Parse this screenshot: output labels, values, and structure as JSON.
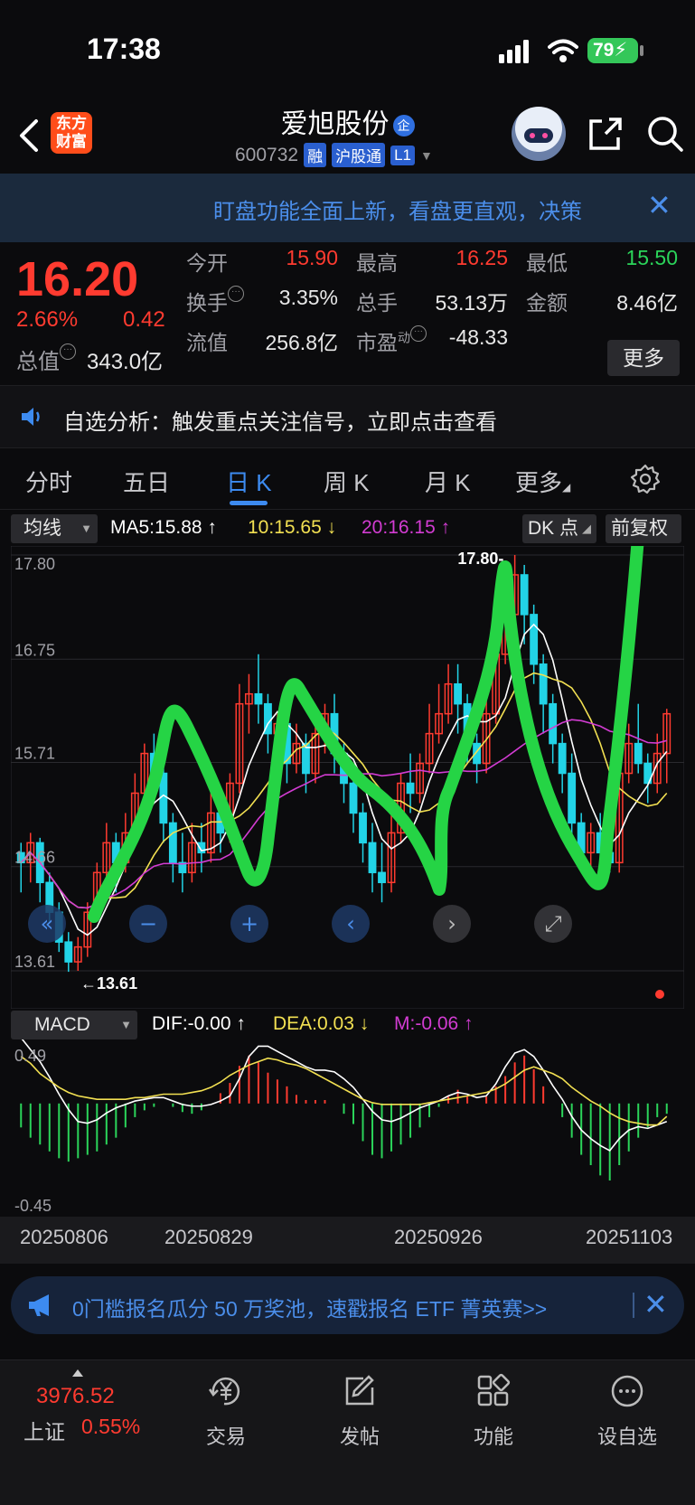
{
  "status": {
    "time": "17:38",
    "battery": "79"
  },
  "nav": {
    "app_logo": [
      "东方",
      "财富"
    ],
    "stock_name": "爱旭股份",
    "name_badge": "企",
    "code": "600732",
    "tags": [
      "融",
      "沪股通",
      "L1"
    ]
  },
  "banner": {
    "text": "盯盘功能全面上新，看盘更直观，决策",
    "close": "✕"
  },
  "quote": {
    "price": "16.20",
    "pct": "2.66%",
    "change": "0.42",
    "mktcap_label": "总值",
    "mktcap": "343.0亿",
    "open_label": "今开",
    "open": "15.90",
    "high_label": "最高",
    "high": "16.25",
    "low_label": "最低",
    "low": "15.50",
    "turnover_label": "换手",
    "turnover": "3.35%",
    "volume_label": "总手",
    "volume": "53.13万",
    "amount_label": "金额",
    "amount": "8.46亿",
    "float_label": "流值",
    "float": "256.8亿",
    "pe_label": "市盈",
    "pe_sup": "动",
    "pe": "-48.33",
    "more": "更多"
  },
  "analysis": {
    "text": "自选分析：触发重点关注信号，立即点击查看"
  },
  "tabs": [
    "分时",
    "五日",
    "日 K",
    "周 K",
    "月 K",
    "更多"
  ],
  "active_tab": 2,
  "ma_row": {
    "ma_select": "均线",
    "ma5": "MA5:15.88 ↑",
    "ma10": "10:15.65 ↓",
    "ma20": "20:16.15 ↑",
    "dk_btn": "DK 点",
    "adjust_btn": "前复权"
  },
  "macd_row": {
    "select": "MACD",
    "dif": "DIF:-0.00 ↑",
    "dea": "DEA:0.03 ↓",
    "m": "M:-0.06 ↑"
  },
  "colors": {
    "up": "#ff3b30",
    "down": "#2bd45a",
    "candle_down": "#22d3e6",
    "ma5": "#ffffff",
    "ma10": "#f2e052",
    "ma20": "#d23cd2",
    "accent": "#3d8bf0"
  },
  "chart_data": {
    "type": "candlestick",
    "title": "",
    "y_ticks": [
      "17.80",
      "16.75",
      "15.71",
      "14.66",
      "13.61"
    ],
    "ylim": [
      13.61,
      17.8
    ],
    "max_label": "17.80",
    "min_label": "←13.61",
    "x_labels": [
      "20250806",
      "20250829",
      "20250926",
      "20251103"
    ],
    "macd_ticks": [
      "0.49",
      "-0.45"
    ],
    "candles": [
      [
        14.8,
        14.7,
        14.9,
        14.4
      ],
      [
        14.7,
        14.9,
        15.0,
        14.5
      ],
      [
        14.9,
        14.5,
        14.95,
        14.3
      ],
      [
        14.5,
        14.2,
        14.6,
        14.1
      ],
      [
        14.2,
        13.9,
        14.3,
        13.8
      ],
      [
        13.9,
        13.7,
        14.0,
        13.6
      ],
      [
        13.7,
        13.85,
        13.95,
        13.61
      ],
      [
        13.85,
        14.2,
        14.3,
        13.75
      ],
      [
        14.2,
        14.6,
        14.7,
        14.1
      ],
      [
        14.6,
        14.9,
        15.1,
        14.5
      ],
      [
        14.9,
        14.7,
        15.0,
        14.4
      ],
      [
        14.7,
        15.0,
        15.2,
        14.6
      ],
      [
        15.0,
        15.4,
        15.6,
        14.9
      ],
      [
        15.4,
        15.8,
        15.9,
        15.3
      ],
      [
        15.8,
        15.6,
        16.0,
        15.4
      ],
      [
        15.6,
        15.1,
        15.7,
        14.9
      ],
      [
        15.1,
        14.7,
        15.2,
        14.5
      ],
      [
        14.7,
        14.6,
        15.0,
        14.4
      ],
      [
        14.6,
        14.9,
        15.1,
        14.5
      ],
      [
        14.9,
        14.8,
        15.1,
        14.6
      ],
      [
        14.8,
        15.2,
        15.4,
        14.7
      ],
      [
        15.2,
        15.0,
        15.3,
        14.8
      ],
      [
        15.0,
        15.5,
        15.6,
        14.9
      ],
      [
        15.5,
        16.3,
        16.5,
        15.4
      ],
      [
        16.3,
        16.4,
        16.6,
        16.0
      ],
      [
        16.4,
        16.3,
        16.8,
        16.1
      ],
      [
        16.3,
        16.0,
        16.4,
        15.8
      ],
      [
        16.0,
        16.1,
        16.2,
        15.7
      ],
      [
        16.1,
        15.7,
        16.2,
        15.5
      ],
      [
        15.7,
        15.9,
        16.1,
        15.6
      ],
      [
        15.9,
        15.6,
        16.0,
        15.4
      ],
      [
        15.6,
        16.0,
        16.2,
        15.5
      ],
      [
        16.0,
        16.2,
        16.3,
        15.8
      ],
      [
        16.2,
        15.8,
        16.4,
        15.6
      ],
      [
        15.8,
        15.5,
        15.9,
        15.3
      ],
      [
        15.5,
        15.2,
        15.6,
        15.0
      ],
      [
        15.2,
        14.9,
        15.3,
        14.7
      ],
      [
        14.9,
        14.6,
        15.1,
        14.4
      ],
      [
        14.6,
        14.5,
        14.9,
        14.3
      ],
      [
        14.5,
        15.0,
        15.2,
        14.4
      ],
      [
        15.0,
        15.5,
        15.6,
        14.9
      ],
      [
        15.5,
        15.4,
        15.8,
        15.2
      ],
      [
        15.4,
        15.7,
        15.8,
        15.3
      ],
      [
        15.7,
        16.0,
        16.3,
        15.6
      ],
      [
        16.0,
        16.2,
        16.5,
        15.9
      ],
      [
        16.2,
        16.5,
        16.7,
        16.1
      ],
      [
        16.5,
        16.3,
        16.7,
        16.0
      ],
      [
        16.3,
        15.9,
        16.4,
        15.7
      ],
      [
        15.9,
        15.7,
        16.0,
        15.5
      ],
      [
        15.7,
        16.2,
        16.4,
        15.6
      ],
      [
        16.2,
        16.8,
        17.0,
        16.1
      ],
      [
        16.8,
        17.2,
        17.5,
        16.7
      ],
      [
        17.2,
        17.6,
        17.8,
        17.1
      ],
      [
        17.6,
        17.2,
        17.7,
        16.9
      ],
      [
        17.2,
        16.7,
        17.3,
        16.5
      ],
      [
        16.7,
        16.3,
        16.8,
        16.0
      ],
      [
        16.3,
        15.9,
        16.4,
        15.7
      ],
      [
        15.9,
        15.6,
        16.0,
        15.4
      ],
      [
        15.6,
        15.1,
        15.8,
        14.9
      ],
      [
        15.1,
        14.8,
        15.2,
        14.7
      ],
      [
        14.8,
        15.0,
        15.1,
        14.6
      ],
      [
        15.0,
        14.8,
        15.2,
        14.7
      ],
      [
        14.8,
        14.7,
        15.1,
        14.6
      ],
      [
        14.7,
        15.6,
        15.9,
        14.6
      ],
      [
        15.6,
        15.9,
        16.1,
        15.5
      ],
      [
        15.9,
        15.7,
        16.3,
        15.6
      ],
      [
        15.7,
        15.5,
        15.8,
        15.3
      ],
      [
        15.5,
        15.8,
        16.0,
        15.4
      ],
      [
        15.8,
        16.2,
        16.25,
        15.5
      ]
    ],
    "macd": {
      "dif": [
        0.49,
        0.42,
        0.35,
        0.26,
        0.16,
        0.07,
        0.0,
        -0.01,
        0.01,
        0.05,
        0.08,
        0.1,
        0.12,
        0.13,
        0.14,
        0.14,
        0.12,
        0.1,
        0.09,
        0.09,
        0.1,
        0.12,
        0.15,
        0.25,
        0.38,
        0.44,
        0.44,
        0.41,
        0.38,
        0.35,
        0.32,
        0.3,
        0.3,
        0.29,
        0.25,
        0.2,
        0.13,
        0.06,
        0.01,
        0.0,
        0.02,
        0.05,
        0.08,
        0.1,
        0.12,
        0.15,
        0.17,
        0.16,
        0.14,
        0.15,
        0.22,
        0.32,
        0.4,
        0.42,
        0.38,
        0.3,
        0.21,
        0.13,
        0.03,
        -0.05,
        -0.1,
        -0.14,
        -0.17,
        -0.1,
        -0.05,
        -0.03,
        -0.04,
        -0.02,
        0.0
      ],
      "dea": [
        0.38,
        0.34,
        0.28,
        0.24,
        0.2,
        0.17,
        0.15,
        0.14,
        0.13,
        0.13,
        0.13,
        0.13,
        0.14,
        0.14,
        0.15,
        0.16,
        0.16,
        0.16,
        0.17,
        0.18,
        0.2,
        0.23,
        0.27,
        0.3,
        0.33,
        0.35,
        0.37,
        0.36,
        0.34,
        0.33,
        0.31,
        0.28,
        0.25,
        0.22,
        0.19,
        0.16,
        0.13,
        0.11,
        0.1,
        0.1,
        0.1,
        0.1,
        0.1,
        0.11,
        0.12,
        0.13,
        0.14,
        0.15,
        0.16,
        0.17,
        0.19,
        0.22,
        0.26,
        0.3,
        0.32,
        0.3,
        0.28,
        0.25,
        0.2,
        0.16,
        0.12,
        0.09,
        0.05,
        0.02,
        0.0,
        -0.01,
        -0.02,
        -0.02,
        0.03
      ],
      "m": [
        -0.14,
        -0.2,
        -0.24,
        -0.28,
        -0.32,
        -0.34,
        -0.32,
        -0.3,
        -0.28,
        -0.24,
        -0.2,
        -0.14,
        -0.08,
        -0.04,
        -0.02,
        0.0,
        -0.02,
        -0.05,
        -0.06,
        -0.04,
        0.0,
        0.06,
        0.12,
        0.22,
        0.28,
        0.24,
        0.18,
        0.14,
        0.1,
        0.05,
        0.02,
        0.02,
        0.02,
        0.0,
        -0.06,
        -0.12,
        -0.22,
        -0.3,
        -0.32,
        -0.28,
        -0.24,
        -0.2,
        -0.14,
        -0.08,
        -0.02,
        0.04,
        0.08,
        0.04,
        0.0,
        0.04,
        0.1,
        0.16,
        0.24,
        0.28,
        0.2,
        0.1,
        0.0,
        -0.08,
        -0.2,
        -0.3,
        -0.36,
        -0.42,
        -0.45,
        -0.36,
        -0.28,
        -0.2,
        -0.14,
        -0.08,
        -0.06
      ]
    }
  },
  "chart_controls": [
    "«",
    "−",
    "+",
    "‹",
    "›",
    "⤢"
  ],
  "ad": {
    "text": "0门槛报名瓜分 50 万奖池，速戳报名 ETF 菁英赛>>",
    "close": "✕"
  },
  "bottom": {
    "index_val": "3976.52",
    "index_name": "上证",
    "index_pct": "0.55%",
    "items": [
      "交易",
      "发帖",
      "功能",
      "设自选"
    ]
  }
}
